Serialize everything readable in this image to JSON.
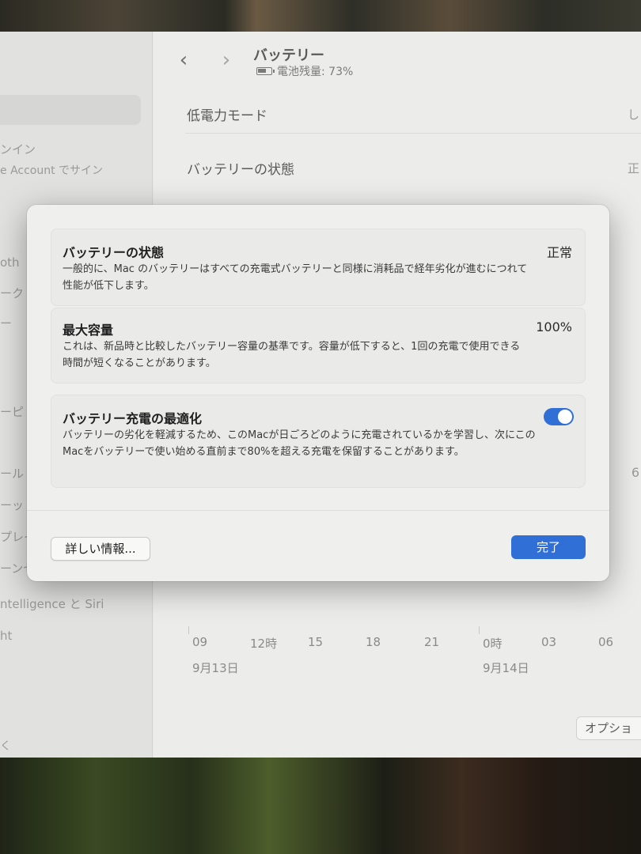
{
  "window": {
    "header": {
      "title": "バッテリー",
      "battery_status": "電池残量: 73%",
      "back_icon": "chevron-left-icon",
      "forward_icon": "chevron-right-icon"
    },
    "sidebar": {
      "items": [
        "ンイン",
        "e Account でサイン",
        "oth",
        "ーク",
        "ー",
        "ーピ",
        "ール",
        "ーッ",
        "プレイ",
        "ーンセ",
        "ntelligence と Siri",
        "ht",
        "く"
      ]
    },
    "settings_rows": [
      {
        "label": "低電力モード",
        "edge": "し"
      },
      {
        "label": "バッテリーの状態",
        "edge": "正"
      }
    ],
    "chart_axis": {
      "hour_labels": [
        "09",
        "12時",
        "15",
        "18",
        "21",
        "0時",
        "03",
        "06"
      ],
      "date_labels": [
        "9月13日",
        "9月14日"
      ],
      "edge_value": "6"
    },
    "options_button": "オプショ"
  },
  "dialog": {
    "battery_health": {
      "title": "バッテリーの状態",
      "value": "正常",
      "description": "一般的に、Mac のバッテリーはすべての充電式バッテリーと同様に消耗品で経年劣化が進むにつれて性能が低下します。"
    },
    "max_capacity": {
      "title": "最大容量",
      "value": "100%",
      "description": "これは、新品時と比較したバッテリー容量の基準です。容量が低下すると、1回の充電で使用できる時間が短くなることがあります。"
    },
    "optimized_charging": {
      "title": "バッテリー充電の最適化",
      "enabled": true,
      "description": "バッテリーの劣化を軽減するため、このMacが日ごろどのように充電されているかを学習し、次にこのMacをバッテリーで使い始める直前まで80%を超える充電を保留することがあります。"
    },
    "buttons": {
      "more_info": "詳しい情報...",
      "done": "完了"
    }
  },
  "colors": {
    "accent": "#2f6fd6",
    "dialog_bg": "#efefed",
    "window_bg": "#ececea"
  }
}
